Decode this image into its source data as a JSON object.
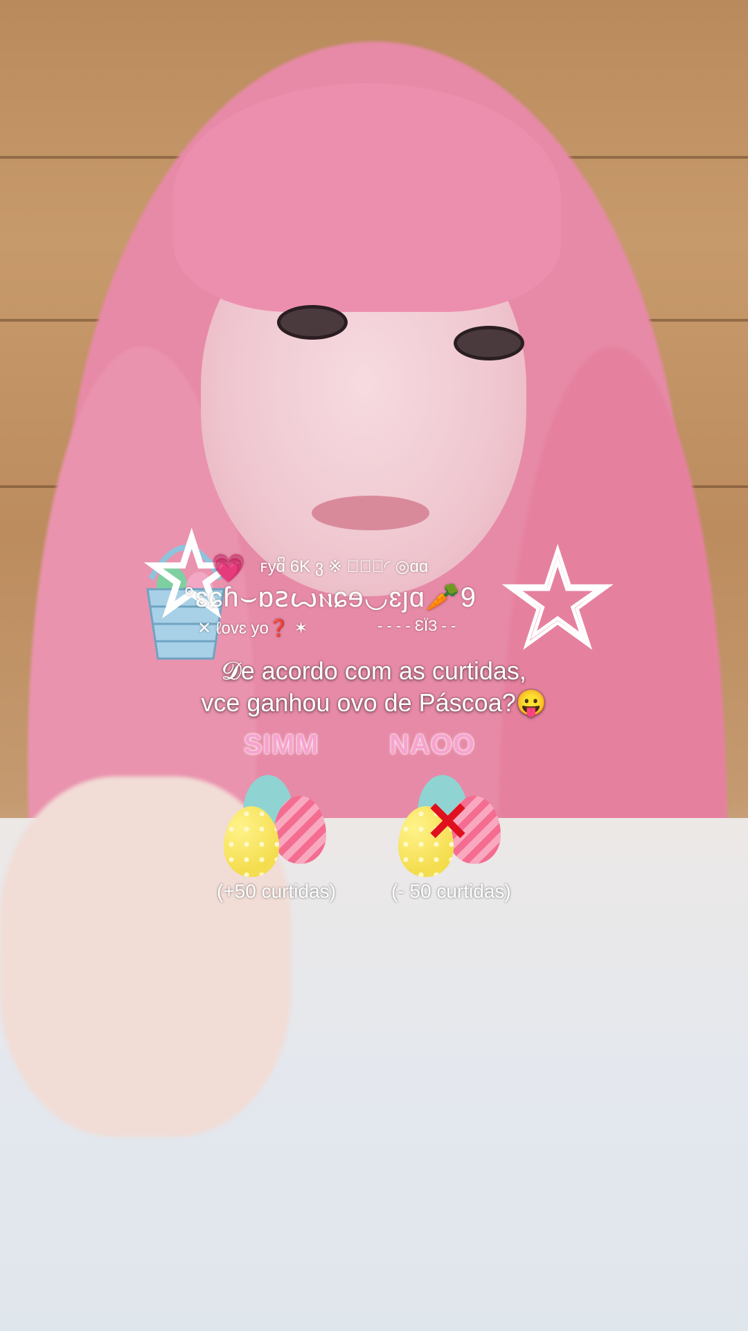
{
  "overlay": {
    "decoration": {
      "top_line": "ꜰyɑᩚ 6K ვ ※  ◝᷼᷼◜  ◎ɑɑ",
      "main_line": "°ɛɕɦ⌣ɒꙅꙍⲛɕɘ◡ɛȷɑ🥕9",
      "love_line": "✕ ℓovɛ yo❓ ✶",
      "dash_line": "- - - - ƐЇЗ - -",
      "heart_emoji": "💗",
      "basket_icon": "easter-basket",
      "star_icon": "star-outline"
    },
    "question_line1": "𝓓e acordo com as curtidas,",
    "question_line2": "vce ganhou ovo de Páscoa?😛",
    "options": [
      {
        "label": "SIMM",
        "sub": "(+50 curtidas)",
        "icon": "easter-eggs"
      },
      {
        "label": "NAOO",
        "sub": "(- 50 curtidas)",
        "icon": "easter-eggs-crossed"
      }
    ]
  },
  "colors": {
    "option_label": "#f7a3cf",
    "hair": "#e98aa8",
    "cross": "#e0101f"
  }
}
